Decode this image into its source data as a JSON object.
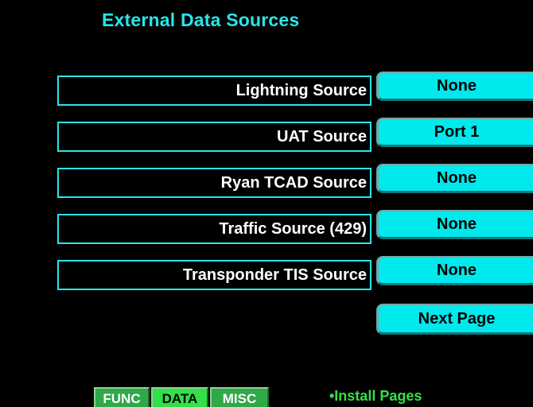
{
  "title": "External Data Sources",
  "rows": [
    {
      "label": "Lightning Source",
      "value": "None"
    },
    {
      "label": "UAT Source",
      "value": "Port 1"
    },
    {
      "label": "Ryan TCAD Source",
      "value": "None"
    },
    {
      "label": "Traffic Source (429)",
      "value": "None"
    },
    {
      "label": "Transponder TIS Source",
      "value": "None"
    }
  ],
  "next_page": "Next Page",
  "tabs": {
    "func": "FUNC",
    "data": "DATA",
    "misc": "MISC"
  },
  "footer": {
    "install_pages": "•Install Pages"
  },
  "colors": {
    "background": "#000000",
    "title": "#27e6ea",
    "button": "#00e9ec",
    "tab_active": "#33e04a",
    "tab_inactive": "#2fa84a"
  }
}
